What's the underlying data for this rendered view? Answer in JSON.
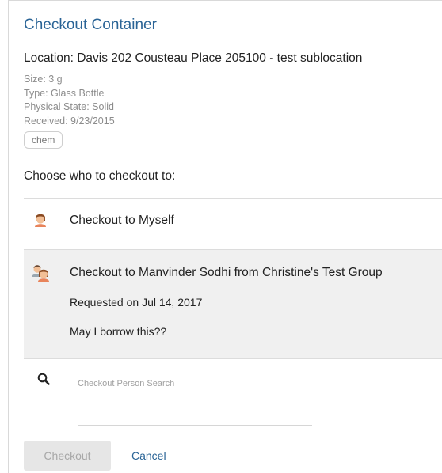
{
  "dialog": {
    "title": "Checkout Container",
    "location": "Location: Davis 202 Cousteau Place 205100 - test sublocation",
    "meta": {
      "size": "Size: 3 g",
      "type": "Type: Glass Bottle",
      "physical_state": "Physical State: Solid",
      "received": "Received: 9/23/2015"
    },
    "tag": "chem",
    "choose_label": "Choose who to checkout to:"
  },
  "options": {
    "myself": {
      "label": "Checkout to Myself",
      "icon": "person-avatar-icon"
    },
    "request": {
      "label": "Checkout to Manvinder Sodhi from Christine's Test Group",
      "requested": "Requested on Jul 14, 2017",
      "message": "May I borrow this??",
      "icon": "group-avatar-icon"
    }
  },
  "search": {
    "placeholder": "Checkout Person Search",
    "value": "",
    "icon": "search-icon"
  },
  "actions": {
    "checkout_label": "Checkout",
    "cancel_label": "Cancel"
  },
  "colors": {
    "accent": "#2a6496",
    "selected_row_bg": "#f0f0f0",
    "disabled_button_bg": "#e6e6e6"
  }
}
